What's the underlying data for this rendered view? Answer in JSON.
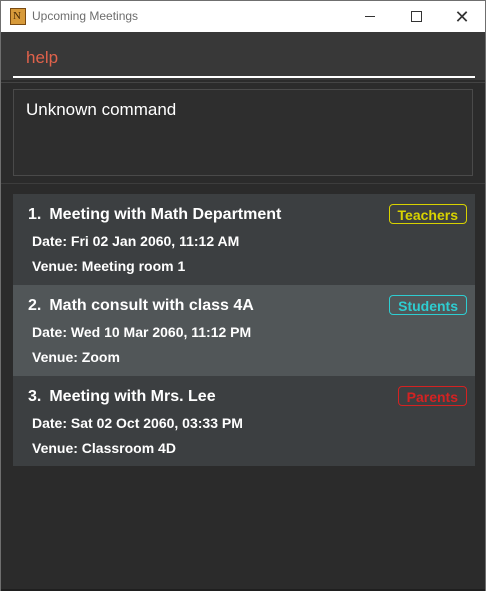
{
  "window": {
    "title": "Upcoming Meetings",
    "icon_letter": "N"
  },
  "command": {
    "value": "help"
  },
  "result": {
    "text": "Unknown command"
  },
  "meetings": [
    {
      "index": "1.",
      "title": "Meeting with Math Department",
      "date": "Date: Fri 02 Jan 2060, 11:12 AM",
      "venue": "Venue: Meeting room 1",
      "tag": "Teachers"
    },
    {
      "index": "2.",
      "title": "Math consult with class 4A",
      "date": "Date: Wed 10 Mar 2060, 11:12 PM",
      "venue": "Venue: Zoom",
      "tag": "Students"
    },
    {
      "index": "3.",
      "title": "Meeting with Mrs. Lee",
      "date": "Date: Sat 02 Oct 2060, 03:33 PM",
      "venue": "Venue: Classroom 4D",
      "tag": "Parents"
    }
  ],
  "colors": {
    "teachers": "#d8d200",
    "students": "#2ecdd1",
    "parents": "#d42222",
    "command": "#e0624b"
  }
}
